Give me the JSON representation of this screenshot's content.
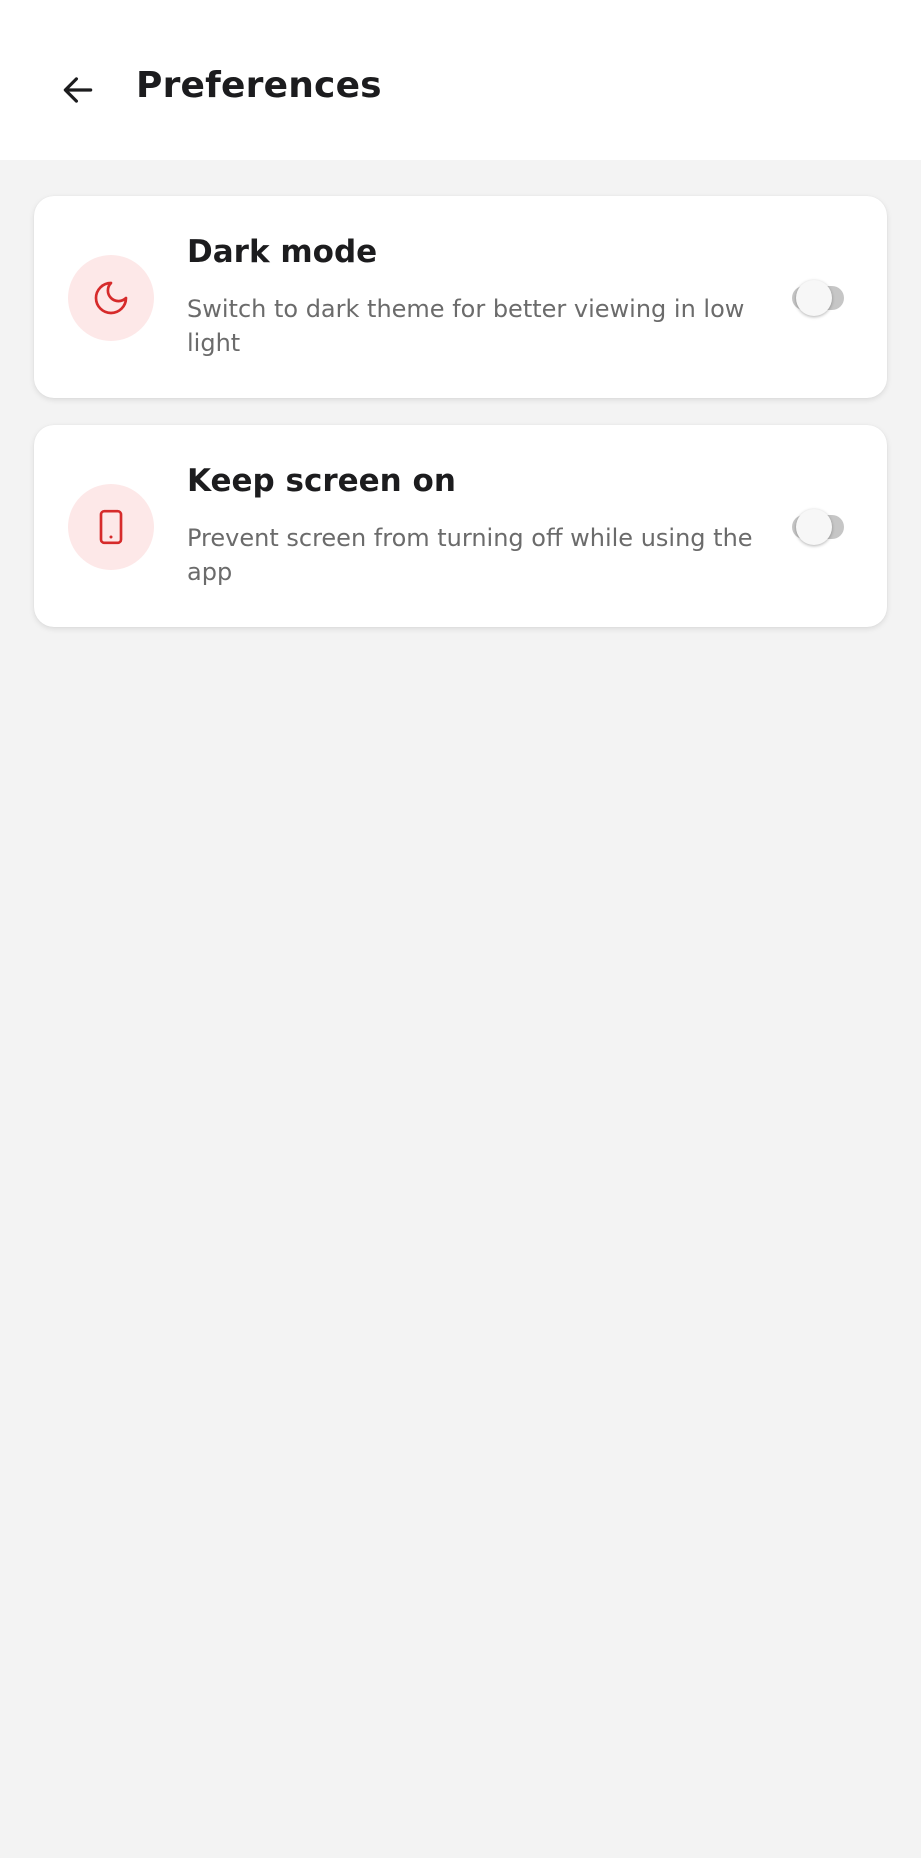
{
  "header": {
    "title": "Preferences",
    "back_icon": "arrow-left-icon"
  },
  "accent_color": "#d62b2b",
  "icon_bg_color": "#fde8e8",
  "settings": [
    {
      "title": "Dark mode",
      "description": "Switch to dark theme for better viewing in low light",
      "icon": "moon-icon",
      "enabled": false
    },
    {
      "title": "Keep screen on",
      "description": "Prevent screen from turning off while using the app",
      "icon": "phone-icon",
      "enabled": false
    }
  ]
}
